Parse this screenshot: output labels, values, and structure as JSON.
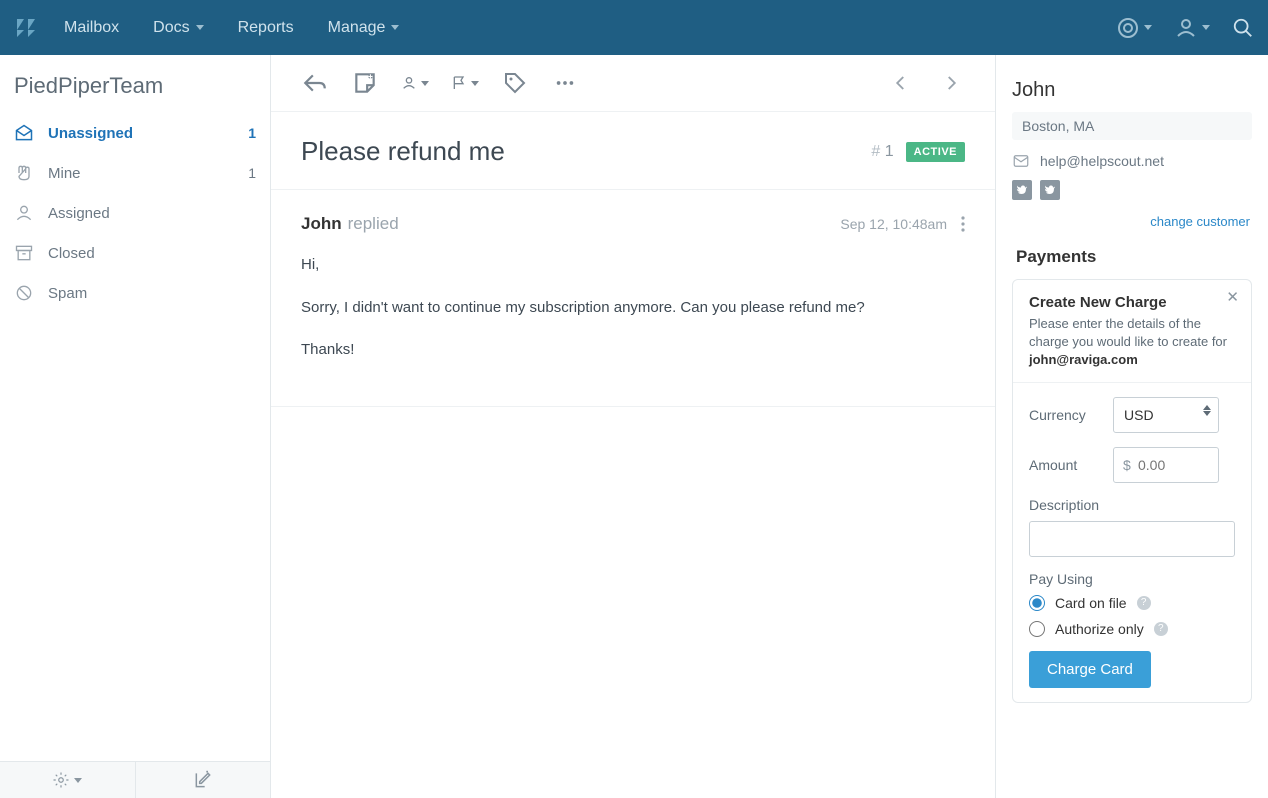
{
  "nav": {
    "items": [
      "Mailbox",
      "Docs",
      "Reports",
      "Manage"
    ]
  },
  "sidebar": {
    "team": "PiedPiperTeam",
    "folders": [
      {
        "label": "Unassigned",
        "count": "1",
        "active": true
      },
      {
        "label": "Mine",
        "count": "1"
      },
      {
        "label": "Assigned"
      },
      {
        "label": "Closed"
      },
      {
        "label": "Spam"
      }
    ]
  },
  "conversation": {
    "subject": "Please refund me",
    "number": "1",
    "status": "ACTIVE",
    "thread": {
      "author": "John",
      "action": "replied",
      "timestamp": "Sep 12, 10:48am",
      "body": [
        "Hi,",
        "Sorry, I didn't want to continue my subscription anymore. Can you please refund me?",
        "Thanks!"
      ]
    }
  },
  "customer": {
    "name": "John",
    "location": "Boston, MA",
    "email": "help@helpscout.net",
    "change_link": "change customer"
  },
  "payments": {
    "section_title": "Payments",
    "charge": {
      "title": "Create New Charge",
      "desc_prefix": "Please enter the details of the charge you would like to create for ",
      "desc_email": "john@raviga.com",
      "currency_label": "Currency",
      "currency_value": "USD",
      "amount_label": "Amount",
      "amount_placeholder": "0.00",
      "description_label": "Description",
      "pay_using_label": "Pay Using",
      "option_card_on_file": "Card on file",
      "option_authorize_only": "Authorize only",
      "button": "Charge Card"
    }
  }
}
